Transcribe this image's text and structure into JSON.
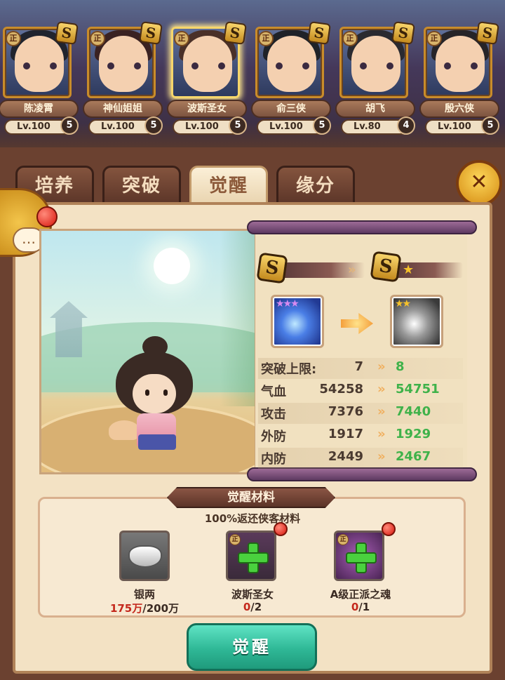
{
  "heroes": [
    {
      "name": "陈凌霄",
      "level": "Lv.100",
      "stars": "5",
      "faction": "正",
      "grade": "S"
    },
    {
      "name": "神仙姐姐",
      "level": "Lv.100",
      "stars": "5",
      "faction": "正",
      "grade": "S"
    },
    {
      "name": "波斯圣女",
      "level": "Lv.100",
      "stars": "5",
      "faction": "正",
      "grade": "S"
    },
    {
      "name": "俞三侠",
      "level": "Lv.100",
      "stars": "5",
      "faction": "正",
      "grade": "S"
    },
    {
      "name": "胡飞",
      "level": "Lv.80",
      "stars": "4",
      "faction": "正",
      "grade": "S"
    },
    {
      "name": "殷六侠",
      "level": "Lv.100",
      "stars": "5",
      "faction": "正",
      "grade": "S"
    }
  ],
  "tabs": [
    {
      "label": "培养"
    },
    {
      "label": "突破"
    },
    {
      "label": "觉醒"
    },
    {
      "label": "缘分"
    }
  ],
  "close_icon": "✕",
  "chat_icon": "…",
  "awaken_panel": {
    "grade_before": "S",
    "grade_after": "S",
    "grade_after_star": "★",
    "chevrons": "»",
    "skill_before_stars": "★★★",
    "skill_after_stars": "★★",
    "stats": [
      {
        "label": "突破上限:",
        "current": "7",
        "next": "8"
      },
      {
        "label": "气血",
        "current": "54258",
        "next": "54751"
      },
      {
        "label": "攻击",
        "current": "7376",
        "next": "7440"
      },
      {
        "label": "外防",
        "current": "1917",
        "next": "1929"
      },
      {
        "label": "内防",
        "current": "2449",
        "next": "2467"
      }
    ]
  },
  "materials": {
    "title": "觉醒材料",
    "subtitle": "100%返还侠客材料",
    "items": [
      {
        "name": "银两",
        "have": "175万",
        "need": "/200万"
      },
      {
        "name": "波斯圣女",
        "have": "0",
        "need": "/2",
        "faction": "正"
      },
      {
        "name": "A级正派之魂",
        "have": "0",
        "need": "/1",
        "faction": "正"
      }
    ]
  },
  "awaken_button": "觉醒",
  "colors": {
    "accent_gold": "#f6d66b",
    "button_teal": "#2fb896",
    "increase_green": "#3fb24a",
    "insufficient_red": "#c4281c"
  }
}
